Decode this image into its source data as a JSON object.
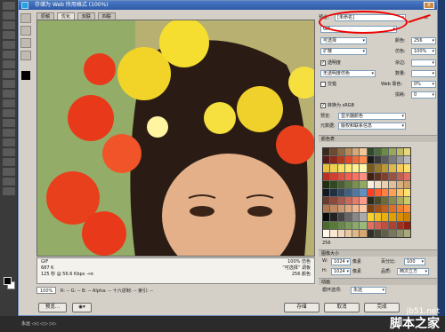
{
  "window": {
    "title": "存储为 Web 所用格式 (100%)",
    "close": "x"
  },
  "preview_tabs": [
    "原稿",
    "优化",
    "双联",
    "四联"
  ],
  "image_info": {
    "format": "GIF",
    "size": "687 K",
    "speed": "125 秒 @ 56.6 Kbps",
    "speed_icon": "→≡",
    "quality": "100% 仿色",
    "palette": "“可选择” 调板",
    "colors": "256 颜色"
  },
  "zoom": {
    "value": "100%",
    "channels": "R: --  G: --  B: --  Alpha: --  十六进制: --  索引: --"
  },
  "buttons": {
    "preview": "预览...",
    "save": "存储",
    "cancel": "取消",
    "done": "完成"
  },
  "settings": {
    "preset_label": "预设：",
    "preset_value": "[未命名]",
    "format_value": "GIF",
    "reduction": "可选择",
    "colors_label": "颜色:",
    "colors_value": "256",
    "dither_algo": "扩散",
    "dither_label": "仿色:",
    "dither_value": "100%",
    "transparency_label": "透明度",
    "matte_label": "杂边:",
    "transparency_dither": "无透明度仿色",
    "amount_label": "数量:",
    "interlaced_label": "交错",
    "web_snap_label": "Web 靠色:",
    "web_snap_value": "0%",
    "lossy_label": "损耗:",
    "lossy_value": "0",
    "convert_srgb": "转换为 sRGB",
    "preview_label": "预览:",
    "preview_value": "显示器颜色",
    "metadata_label": "元数据:",
    "metadata_value": "版权和联系信息",
    "color_table_label": "颜色表",
    "palette_count": "256"
  },
  "image_size": {
    "section_label": "图像大小",
    "width_label": "W:",
    "width_value": "1024",
    "height_label": "H:",
    "height_value": "1024",
    "unit": "像素",
    "percent_label": "百分比:",
    "percent_value": "100",
    "quality_label": "品质:",
    "quality_value": "两次立方"
  },
  "animation": {
    "section_label": "动画",
    "loop_label": "循环选项:",
    "loop_value": "永远"
  },
  "taskbar": {
    "items": "永远  ◁◁  ◁  ▷  ▷▷"
  },
  "watermark": {
    "url": "jb51.net",
    "name": "脚本之家"
  },
  "palette_colors": [
    "#3a2a1e",
    "#6b4a30",
    "#8f6a45",
    "#b88a5a",
    "#d9a878",
    "#f0c89a",
    "#2e4a2a",
    "#4e6a3a",
    "#6e8a4a",
    "#98a85a",
    "#c0b86a",
    "#e8d87a",
    "#5a1a1a",
    "#8a2a1a",
    "#b83a1a",
    "#e04a2a",
    "#f06a3a",
    "#ff8a4a",
    "#1a1a1a",
    "#3a3a3a",
    "#5a5a5a",
    "#7a7a7a",
    "#9a9a9a",
    "#bababa",
    "#e8c040",
    "#f0d050",
    "#f8e060",
    "#ffe878",
    "#fff090",
    "#fff8b0",
    "#7a5a1a",
    "#9a7a2a",
    "#ba9a3a",
    "#daba4a",
    "#facA5a",
    "#ffe06a",
    "#c03020",
    "#d04030",
    "#e05040",
    "#f06050",
    "#ff7060",
    "#ff9080",
    "#402010",
    "#603020",
    "#804030",
    "#a05040",
    "#c06050",
    "#e07060",
    "#203010",
    "#304820",
    "#486030",
    "#607840",
    "#789050",
    "#90a860",
    "#f8f0e0",
    "#f0e0c8",
    "#e8d0b0",
    "#e0c098",
    "#d8b080",
    "#d0a068",
    "#101820",
    "#203040",
    "#304860",
    "#406080",
    "#5078a0",
    "#6090c0",
    "#ff4020",
    "#ff6030",
    "#ff8040",
    "#ffa050",
    "#ffc060",
    "#ffe070",
    "#6a3a2a",
    "#8a4a3a",
    "#aa5a4a",
    "#ca6a5a",
    "#ea7a6a",
    "#ff9a8a",
    "#2a2a1a",
    "#4a4a2a",
    "#6a6a3a",
    "#8a8a4a",
    "#aaaa5a",
    "#caca6a",
    "#b07850",
    "#c08860",
    "#d09870",
    "#e0a880",
    "#f0b890",
    "#ffc8a0",
    "#804010",
    "#a05018",
    "#c06020",
    "#e07028",
    "#f08030",
    "#ff9040",
    "#0a0a0a",
    "#222222",
    "#444444",
    "#666666",
    "#888888",
    "#aaaaaa",
    "#f8d030",
    "#f0c020",
    "#e8b010",
    "#e0a000",
    "#d89000",
    "#d08000",
    "#4a6a2a",
    "#5a7a3a",
    "#6a8a4a",
    "#7a9a5a",
    "#8aaa6a",
    "#9aba7a",
    "#e07060",
    "#d06050",
    "#c05040",
    "#b04030",
    "#a03020",
    "#902010",
    "#fff8e8",
    "#f8e8d0",
    "#f0d8b8",
    "#e8c8a0",
    "#e0b888",
    "#d8a870",
    "#303028",
    "#484838",
    "#606048",
    "#787858",
    "#909068",
    "#a8a878"
  ]
}
